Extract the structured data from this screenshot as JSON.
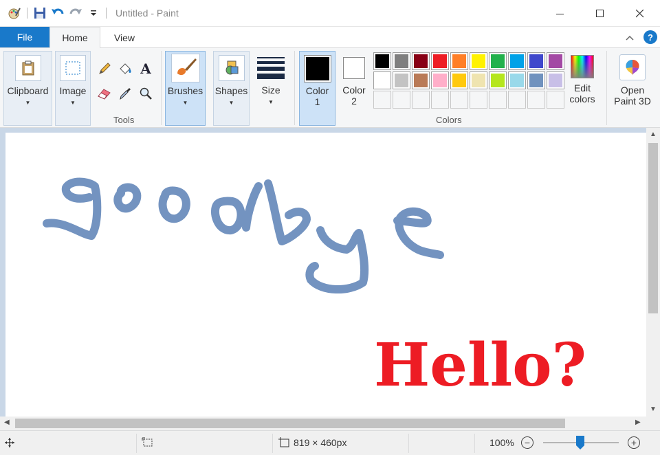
{
  "window": {
    "title": "Untitled - Paint"
  },
  "tabs": {
    "file": "File",
    "home": "Home",
    "view": "View"
  },
  "ribbon": {
    "clipboard": "Clipboard",
    "image": "Image",
    "tools_group": "Tools",
    "brushes": "Brushes",
    "shapes": "Shapes",
    "size": "Size",
    "color1_line1": "Color",
    "color1_line2": "1",
    "color2_line1": "Color",
    "color2_line2": "2",
    "colors_group": "Colors",
    "edit_colors_line1": "Edit",
    "edit_colors_line2": "colors",
    "open3d_line1": "Open",
    "open3d_line2": "Paint 3D",
    "text_tool_glyph": "A"
  },
  "palette": {
    "row1": [
      "#000000",
      "#7f7f7f",
      "#880015",
      "#ed1c24",
      "#ff7f27",
      "#fff200",
      "#22b14c",
      "#00a2e8",
      "#3f48cc",
      "#a349a4"
    ],
    "row2": [
      "#ffffff",
      "#c3c3c3",
      "#b97a57",
      "#ffaec9",
      "#ffc90e",
      "#efe4b0",
      "#b5e61d",
      "#99d9ea",
      "#7092be",
      "#c8bfe7"
    ],
    "row3_empty_count": 10,
    "color1": "#000000",
    "color2": "#ffffff"
  },
  "canvas": {
    "hello_text": "Hello?",
    "hello_color": "#ed1c24",
    "goodbye_stroke_color": "#7393c0"
  },
  "statusbar": {
    "dimensions": "819 × 460px",
    "zoom": "100%",
    "zoom_minus": "−",
    "zoom_plus": "+"
  },
  "icons": [
    "paint-app-icon",
    "save-icon",
    "undo-icon",
    "redo-icon",
    "customize-qat-icon",
    "minimize-icon",
    "maximize-icon",
    "close-icon",
    "collapse-ribbon-icon",
    "help-icon",
    "pencil-icon",
    "fill-icon",
    "text-icon",
    "eraser-icon",
    "color-picker-icon",
    "magnifier-icon",
    "move-cursor-icon",
    "selection-size-icon",
    "canvas-size-icon"
  ]
}
